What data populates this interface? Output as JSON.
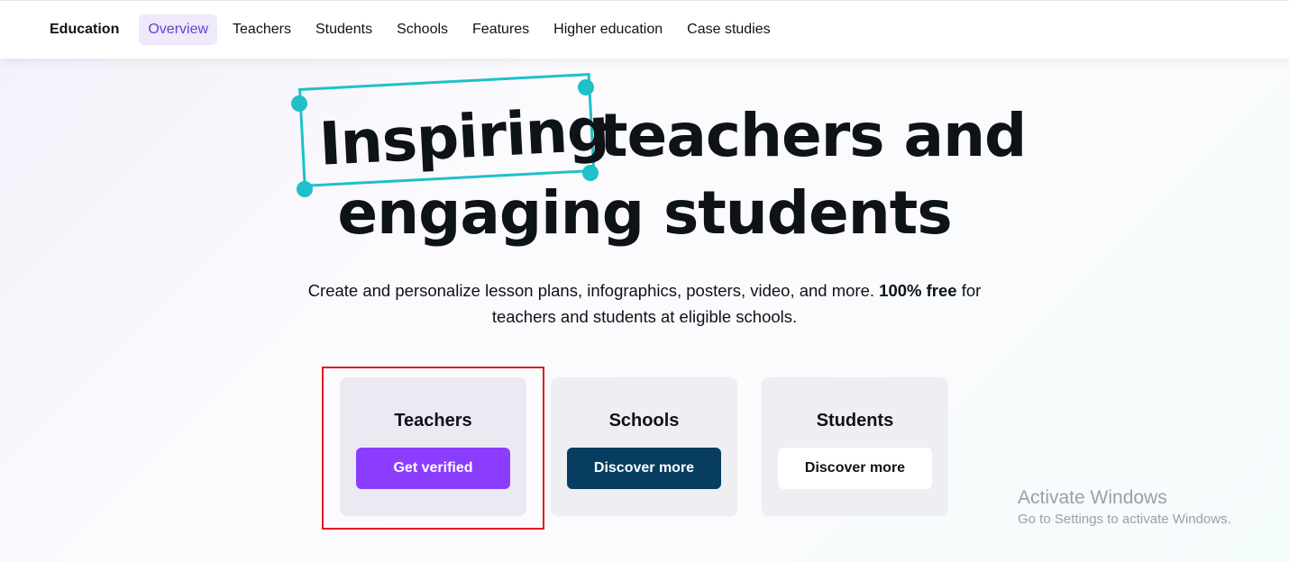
{
  "nav": {
    "brand": "Education",
    "items": [
      "Overview",
      "Teachers",
      "Students",
      "Schools",
      "Features",
      "Higher education",
      "Case studies"
    ],
    "active": "Overview"
  },
  "hero": {
    "highlight": "Inspiring",
    "line1_rest": "teachers and",
    "line2": "engaging students",
    "subtitle_part1": "Create and personalize lesson plans, infographics, posters, video, and more.",
    "subtitle_bold": "100% free",
    "subtitle_part2": "for teachers and students at eligible schools."
  },
  "cards": [
    {
      "title": "Teachers",
      "button": "Get verified"
    },
    {
      "title": "Schools",
      "button": "Discover more"
    },
    {
      "title": "Students",
      "button": "Discover more"
    }
  ],
  "watermark": {
    "line1": "Activate Windows",
    "line2": "Go to Settings to activate Windows."
  },
  "colors": {
    "accent_purple": "#8b3dff",
    "navy": "#083d62",
    "teal_frame": "#1fc0c8",
    "selection_red": "#e0191f"
  }
}
